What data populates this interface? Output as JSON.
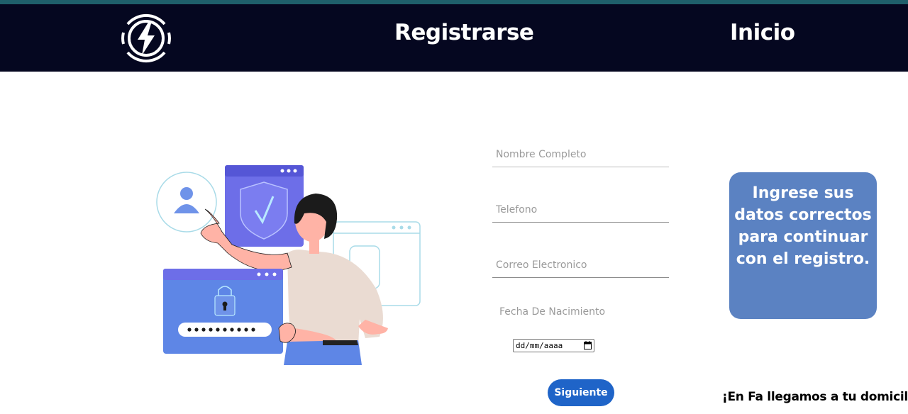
{
  "navbar": {
    "logo_icon": "lightning-bolt-logo-icon",
    "register_label": "Registrarse",
    "home_label": "Inicio"
  },
  "form": {
    "name_placeholder": "Nombre Completo",
    "phone_placeholder": "Telefono",
    "email_placeholder": "Correo Electronico",
    "dob_label": "Fecha De Nacimiento",
    "dob_value": "dd/mm/aaaa",
    "next_label": "Siguiente"
  },
  "info_card": {
    "text": "Ingrese sus datos correctos para continuar con el registro."
  },
  "footer": {
    "slogan": "¡En Fa llegamos a tu domicilio!"
  },
  "colors": {
    "navbar": "#050720",
    "button": "#1f64c8",
    "card": "#5b82c2"
  }
}
